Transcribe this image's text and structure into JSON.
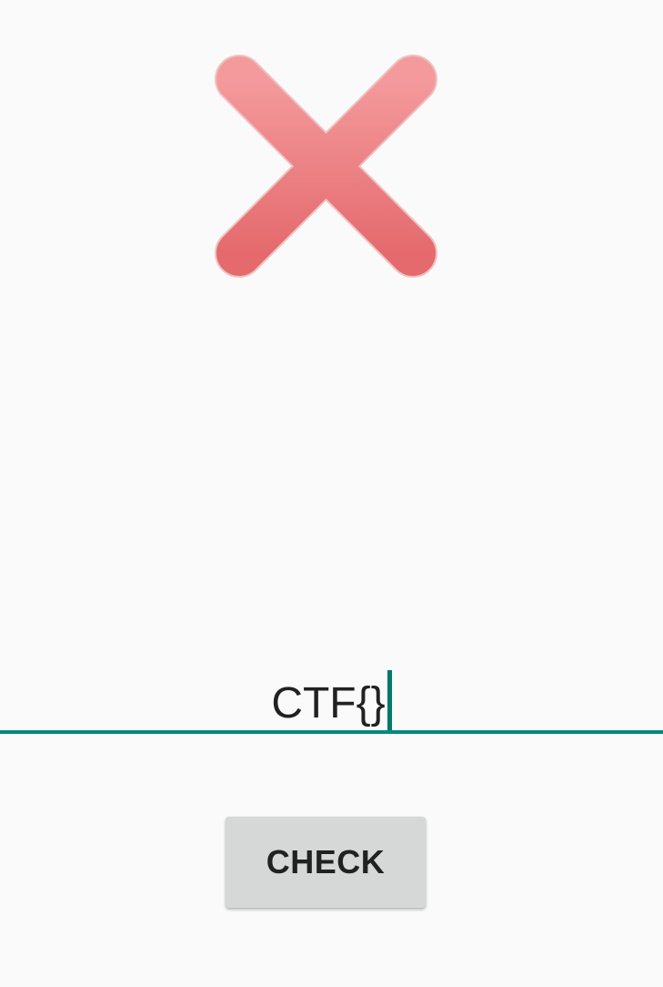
{
  "result": {
    "icon": "cross-icon",
    "state": "incorrect",
    "color": "#e86f72"
  },
  "flag_input": {
    "value": "CTF{}",
    "accent_color": "#00897b"
  },
  "check_button": {
    "label": "CHECK"
  }
}
